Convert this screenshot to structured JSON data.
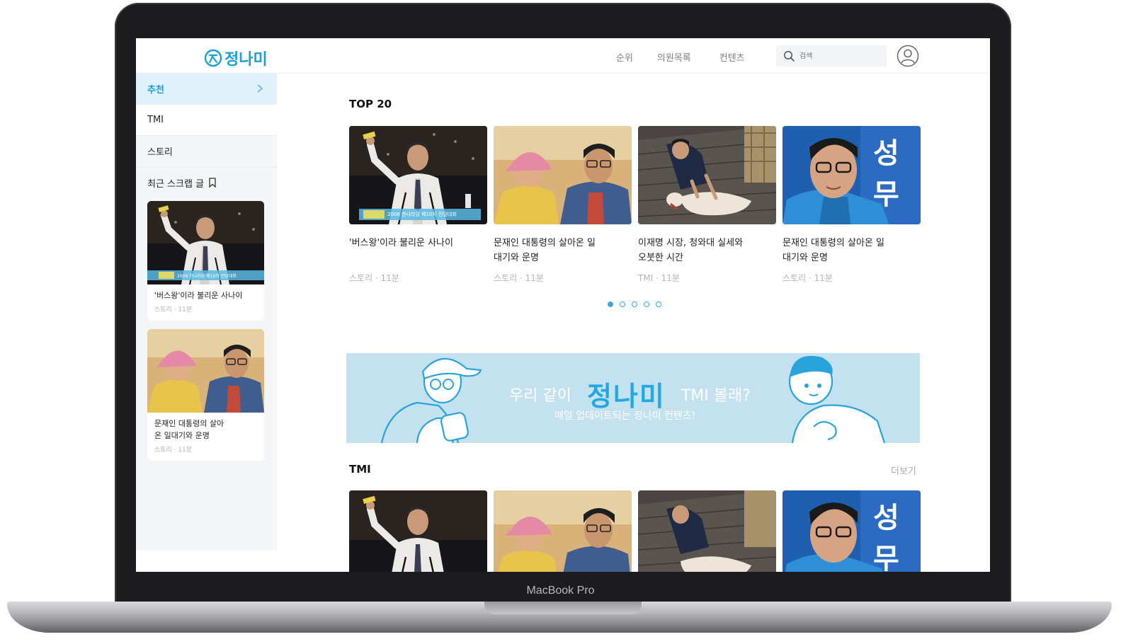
{
  "device": {
    "label": "MacBook Pro"
  },
  "header": {
    "logo_text": "정나미",
    "nav": [
      "순위",
      "의원목록",
      "컨텐츠"
    ],
    "search_placeholder": "검색"
  },
  "sidebar": {
    "items": [
      {
        "label": "추천"
      },
      {
        "label": "TMI"
      },
      {
        "label": "스토리"
      }
    ],
    "scrap_heading": "최근 스크랩 글",
    "scrap_cards": [
      {
        "title": "'버스왕'이라 불리운 사나이",
        "meta": "스토리 · 11분",
        "caption": "2008 한나라당 제10차 전당대회"
      },
      {
        "title": "문재인 대통령의 살아온 일대기와 운명",
        "meta": "스토리 · 11분"
      }
    ]
  },
  "top20": {
    "title": "TOP 20",
    "cards": [
      {
        "title": "'버스왕'이라 불리운 사나이",
        "meta": "스토리 · 11분",
        "caption": "2008 한나라당 제10차 전당대회"
      },
      {
        "title": "문재인 대통령의 살아온 일대기와 운명",
        "meta": "스토리 · 11분"
      },
      {
        "title": "이재명 시장, 청와대 실세와 오붓한 시간",
        "meta": "TMI · 11분"
      },
      {
        "title": "문재인 대통령의 살아온 일대기와 운명",
        "meta": "스토리 · 11분",
        "sign_text": "성무"
      }
    ],
    "pagination": {
      "total": 5,
      "current": 1
    }
  },
  "banner": {
    "prefix": "우리 같이",
    "brand": "정나미",
    "suffix": "TMI 볼래?",
    "subtitle": "매일 업데이트되는 정나미 컨텐츠!"
  },
  "tmi": {
    "title": "TMI",
    "more_label": "더보기",
    "cards": [
      {
        "caption": ""
      },
      {
        "caption": ""
      },
      {
        "caption": ""
      },
      {
        "sign_text": "성무"
      }
    ]
  },
  "colors": {
    "brand": "#1a9fd9",
    "banner_bg": "#c3e1ee",
    "active_bg": "#dff1fb"
  },
  "icons": [
    "logo-icon",
    "search-icon",
    "profile-icon",
    "chevron-right-icon",
    "bookmark-icon"
  ]
}
